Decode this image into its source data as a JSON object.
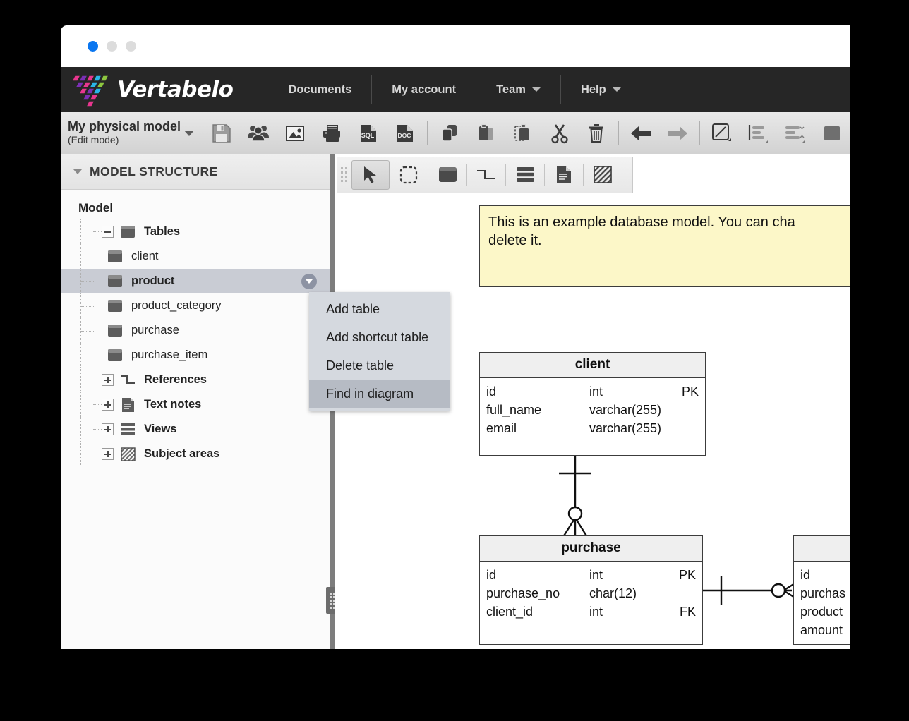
{
  "window": {
    "traffic_lights": [
      "blue",
      "grey",
      "grey"
    ],
    "accent": "#0a76f0"
  },
  "navbar": {
    "brand": "Vertabelo",
    "brand_colors": [
      "#e8368f",
      "#7b2fb5",
      "#29b6e8",
      "#8dc63f"
    ],
    "background": "#262626",
    "items": [
      {
        "label": "Documents",
        "has_caret": false
      },
      {
        "label": "My account",
        "has_caret": false
      },
      {
        "label": "Team",
        "has_caret": true
      },
      {
        "label": "Help",
        "has_caret": true
      }
    ]
  },
  "toolbar": {
    "model_name": "My physical model",
    "model_mode": "(Edit mode)",
    "dropdown_icon": "caret-down-icon",
    "buttons": [
      {
        "name": "save-icon",
        "title": "Save"
      },
      {
        "name": "share-users-icon",
        "title": "Share"
      },
      {
        "name": "export-image-icon",
        "title": "Export image"
      },
      {
        "name": "print-icon",
        "title": "Print"
      },
      {
        "name": "export-sql-icon",
        "title": "SQL",
        "text": "SQL"
      },
      {
        "name": "export-doc-icon",
        "title": "Documentation",
        "text": "DOC"
      },
      {
        "name": "copy-icon",
        "title": "Copy"
      },
      {
        "name": "paste-icon",
        "title": "Paste"
      },
      {
        "name": "paste-special-icon",
        "title": "Paste special"
      },
      {
        "name": "cut-icon",
        "title": "Cut"
      },
      {
        "name": "delete-trash-icon",
        "title": "Delete"
      },
      {
        "name": "undo-arrow-icon",
        "title": "Undo"
      },
      {
        "name": "redo-arrow-icon",
        "title": "Redo"
      },
      {
        "name": "line-style-icon",
        "title": "Line style"
      },
      {
        "name": "align-left-icon",
        "title": "Align"
      },
      {
        "name": "distribute-icon",
        "title": "Distribute"
      },
      {
        "name": "more-tools-icon",
        "title": "More"
      }
    ]
  },
  "sidebar": {
    "panel_title": "MODEL STRUCTURE",
    "collapse_icon": "caret-down-icon",
    "root_label": "Model",
    "tree": [
      {
        "label": "Tables",
        "bold": true,
        "level": 1,
        "toggle": "minus",
        "icon": "table-icon",
        "selected": false
      },
      {
        "label": "client",
        "bold": false,
        "level": 2,
        "toggle": "none",
        "icon": "table-icon",
        "selected": false
      },
      {
        "label": "product",
        "bold": true,
        "level": 2,
        "toggle": "none",
        "icon": "table-icon",
        "selected": true,
        "menu_button": "context-caret-icon"
      },
      {
        "label": "product_category",
        "bold": false,
        "level": 2,
        "toggle": "none",
        "icon": "table-icon",
        "selected": false
      },
      {
        "label": "purchase",
        "bold": false,
        "level": 2,
        "toggle": "none",
        "icon": "table-icon",
        "selected": false
      },
      {
        "label": "purchase_item",
        "bold": false,
        "level": 2,
        "toggle": "none",
        "icon": "table-icon",
        "selected": false
      },
      {
        "label": "References",
        "bold": true,
        "level": 1,
        "toggle": "plus",
        "icon": "reference-icon",
        "selected": false
      },
      {
        "label": "Text notes",
        "bold": true,
        "level": 1,
        "toggle": "plus",
        "icon": "note-icon",
        "selected": false
      },
      {
        "label": "Views",
        "bold": true,
        "level": 1,
        "toggle": "plus",
        "icon": "view-icon",
        "selected": false
      },
      {
        "label": "Subject areas",
        "bold": true,
        "level": 1,
        "toggle": "plus",
        "icon": "subject-area-icon",
        "selected": false
      }
    ]
  },
  "context_menu": {
    "items": [
      {
        "label": "Add table",
        "highlighted": false
      },
      {
        "label": "Add shortcut table",
        "highlighted": false
      },
      {
        "label": "Delete table",
        "highlighted": false
      },
      {
        "label": "Find in diagram",
        "highlighted": true
      }
    ]
  },
  "diagram_toolbar": {
    "buttons": [
      {
        "name": "pointer-select-icon",
        "active": true
      },
      {
        "name": "marquee-select-icon",
        "active": false
      },
      {
        "name": "add-table-icon",
        "active": false
      },
      {
        "name": "add-reference-icon",
        "active": false
      },
      {
        "name": "add-view-icon",
        "active": false
      },
      {
        "name": "add-note-icon",
        "active": false
      },
      {
        "name": "add-subject-area-icon",
        "active": false
      }
    ]
  },
  "diagram": {
    "note": {
      "text": "This is an example database model. You can cha\ndelete it.",
      "background": "#fcf7c8"
    },
    "tables": [
      {
        "name": "client",
        "columns": [
          {
            "name": "id",
            "type": "int",
            "key": "PK"
          },
          {
            "name": "full_name",
            "type": "varchar(255)",
            "key": ""
          },
          {
            "name": "email",
            "type": "varchar(255)",
            "key": ""
          }
        ]
      },
      {
        "name": "purchase",
        "columns": [
          {
            "name": "id",
            "type": "int",
            "key": "PK"
          },
          {
            "name": "purchase_no",
            "type": "char(12)",
            "key": ""
          },
          {
            "name": "client_id",
            "type": "int",
            "key": "FK"
          }
        ]
      },
      {
        "name": "",
        "columns": [
          {
            "name": "id",
            "type": "",
            "key": ""
          },
          {
            "name": "purchas",
            "type": "",
            "key": ""
          },
          {
            "name": "product",
            "type": "",
            "key": ""
          },
          {
            "name": "amount",
            "type": "",
            "key": ""
          }
        ]
      }
    ]
  }
}
